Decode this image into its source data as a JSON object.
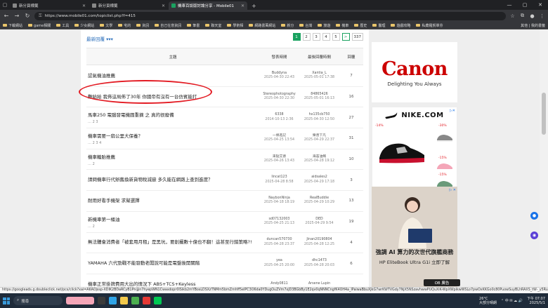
{
  "browser": {
    "tabs": [
      {
        "title": "新分頁標籤",
        "active": false
      },
      {
        "title": "新分頁標籤",
        "active": false
      },
      {
        "title": "機車百談版討論分享 - Mobile01",
        "active": true
      }
    ],
    "url": "https://www.mobile01.com/topiclist.php?f=415",
    "bookmarks": [
      "下載網站",
      "game相關",
      "工具",
      "少女網站",
      "文學",
      "宅的",
      "資訊",
      "自己在意資訊",
      "筆書",
      "聯天室",
      "學術相",
      "網路書萬網站",
      "新分",
      "台灣",
      "旅遊",
      "機車",
      "歷史",
      "醫理",
      "遊戲攻略",
      "私藏羅賀單芬"
    ],
    "bookmarks_right": "其他 | 我的書籤"
  },
  "page": {
    "back_link": "最新回覆 ▾▾▾",
    "pagination": {
      "pages": [
        "1",
        "2",
        "3",
        "4",
        "5"
      ],
      "next": ">",
      "last": "337",
      "current": "1"
    },
    "headers": {
      "topic": "主題",
      "post_time": "發表時間",
      "last_reply": "最後回覆時間",
      "replies": "回覆"
    },
    "rows": [
      {
        "title": "認氣機油推薦",
        "pages": "",
        "author": "Buddyna",
        "post_date": "2025-04-30 22:43",
        "replier": "Xantia_L",
        "reply_date": "2025-05-01 17:38",
        "count": "7"
      },
      {
        "title": "難給給 我佈這局佈了30年 你國帝有沒有一台仿賓能打",
        "pages": "",
        "author": "Stereophotography",
        "post_date": "2025-04-30 22:30",
        "replier": "84865426",
        "reply_date": "2025-05-01 16:13",
        "count": "16"
      },
      {
        "title": "馬車250 電腦發電機圓重摘 之 真的很廢備",
        "pages": "… 2 3",
        "author": "6338",
        "post_date": "2014-10-13 2:36",
        "replier": "hx135cb750",
        "reply_date": "2025-04-30 12:50",
        "count": "27"
      },
      {
        "title": "機車需要一扇公里大保養？",
        "pages": "… 2 3 4",
        "author": "一條進記",
        "post_date": "2025-04-25 13:54",
        "replier": "樂善下凡",
        "reply_date": "2025-04-29 22:37",
        "count": "31"
      },
      {
        "title": "機車輪胎推薦",
        "pages": "… 2",
        "author": "來點艾德",
        "post_date": "2025-04-26 13:43",
        "replier": "海苔油鮪",
        "reply_date": "2025-04-28 19:12",
        "count": "10"
      },
      {
        "title": "請問機車行代辦舊換新貨物稅減嶽 多久能在網路上查到進度？",
        "pages": "",
        "author": "lincat123",
        "post_date": "2025-04-28 8:58",
        "replier": "aidsales2",
        "reply_date": "2025-04-29 17:18",
        "count": "3"
      },
      {
        "title": "耐用好看手機架 求幫選擇",
        "pages": "",
        "author": "NaybonNinja",
        "post_date": "2025-04-18 18:19",
        "replier": "RealBuddie",
        "reply_date": "2025-04-29 10:29",
        "count": "13"
      },
      {
        "title": "新機車第一桶油",
        "pages": "… 2",
        "author": "sd07132003",
        "post_date": "2025-04-25 21:13",
        "replier": "DED",
        "reply_date": "2025-04-29 9:54",
        "count": "19"
      },
      {
        "title": "無法體會消費者「被套用月租」是黑坑，要創攝數十億也不翻！這甚至行銷策略?!",
        "pages": "",
        "author": "duncan570730",
        "post_date": "2025-04-28 23:37",
        "replier": "Jinan20190804",
        "reply_date": "2025-04-28 12:25",
        "count": "4"
      },
      {
        "title": "YAMAHA 六代勁戰不能發動老闆說可能是電盤後開關階",
        "pages": "",
        "author": "yea",
        "post_date": "2025-04-25 20:00",
        "replier": "dhc1473",
        "reply_date": "2025-04-28 20:03",
        "count": "6"
      },
      {
        "title": "機車正常掛牌費用大出的情況下 ABS+TCS+Keyless",
        "pages": "",
        "author": "Andy0811",
        "post_date": "",
        "replier": "Arsene Lupin",
        "reply_date": "",
        "count": ""
      }
    ]
  },
  "ads": {
    "canon": {
      "logo": "Canon",
      "tagline": "Delighting You Always"
    },
    "nike": {
      "brand": "NIKE.COM",
      "discounts": [
        "-14%",
        "-30%",
        "-15%",
        "-15%"
      ]
    },
    "hp": {
      "headline": "強調 AI 算力的次世代旗艦商務",
      "subline": "HP EliteBook Ultra G1i 立即了解",
      "badge": "▷ ✕"
    },
    "ob": "OB 廣告",
    "colors": {
      "canon_red": "#cc0000",
      "accent_green": "#1aa260",
      "highlight_red": "#e31b23"
    }
  },
  "status_url": "https://googleads.g.doubleclick.net/pcs/click?xai=AKAOjssp-XDIK2BDaRCyB1Pn@n7hyepWN1Cwasdopr0ISikb2mYBosLDSXzTNMm5bmZmhff5eIPC3O6da0YDugOuZVm7xjD3BGbBy1E2qv0qNNNCngfK4OH4a_IPaiwaBbuXJkG7wrKWTVGdy7NjX5NSzavhwwPUQuXiK-WpXWpikwWSLo7pwOxKKGo0c80PuowSuyBLhRAXS_tW-_y5Ruc7IMRR0QrvYFSQnJNFBp3",
  "taskbar": {
    "search": "搜尋",
    "weather_temp": "26°C",
    "weather_desc": "大部分晴朗",
    "time": "下午 07:07",
    "date": "2025/5/1"
  }
}
